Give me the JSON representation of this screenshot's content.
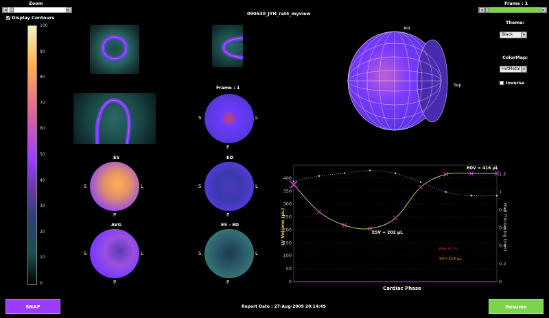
{
  "header": {
    "zoom_label": "Zoom",
    "title": "090630_JYH_rat4_myview",
    "frame_label": "Frame : 1"
  },
  "display_contours_label": "Display Contours",
  "colorbar": {
    "ticks": [
      "100",
      "90",
      "80",
      "70",
      "60",
      "50",
      "40",
      "30",
      "20",
      "10",
      "0"
    ]
  },
  "panels": {
    "frame_label": "Frame : 1",
    "es_label": "ES",
    "ed_label": "ED",
    "avg_label": "AVG",
    "es_ed_label": "ES - ED",
    "orient": {
      "s": "S",
      "l": "L",
      "p": "P"
    }
  },
  "view3d": {
    "ant_label": "Ant",
    "sep_label": "Sep"
  },
  "right_panel": {
    "theme_label": "Theme:",
    "theme_value": "Black",
    "colormap_label": "ColorMap:",
    "colormap_value": "HotMetal",
    "inverse_label": "Inverse"
  },
  "chart_data": {
    "type": "line",
    "xlabel": "Cardiac Phase",
    "ylabel": "LV Volume (μL)",
    "y2label": "Wall Thickening (mm)",
    "ylim": [
      0,
      450
    ],
    "y2lim": [
      0,
      1.3
    ],
    "yticks": [
      0,
      50,
      100,
      150,
      200,
      250,
      300,
      350,
      400
    ],
    "y2ticks": [
      0,
      0.2,
      0.4,
      0.6,
      0.8,
      1,
      1.2
    ],
    "x": [
      1,
      2,
      3,
      4,
      5,
      6,
      7,
      8,
      9
    ],
    "series": [
      {
        "values": [
          375,
          270,
          218,
          205,
          245,
          365,
          415,
          418,
          418
        ]
      },
      {
        "values": [
          1.12,
          1.18,
          1.21,
          1.24,
          1.21,
          1.11,
          1.0,
          0.96,
          0.96
        ]
      }
    ],
    "annotations": {
      "edv": "EDV = 416 μL",
      "esv": "ESV = 202 μL",
      "ef": "EF= 51 %",
      "sv": "SV= 214 μL"
    }
  },
  "footer": {
    "snap_label": "SNAP",
    "report_date": "Report Date : 27-Aug-2009 20:14:49",
    "resume_label": "Resume"
  },
  "colors": {
    "snap_bg": "#9a3cff",
    "resume_bg": "#7dd44a",
    "frame_slider": "#7dd44a",
    "volume_curve": "#c8c860",
    "marker": "#d040d0"
  }
}
